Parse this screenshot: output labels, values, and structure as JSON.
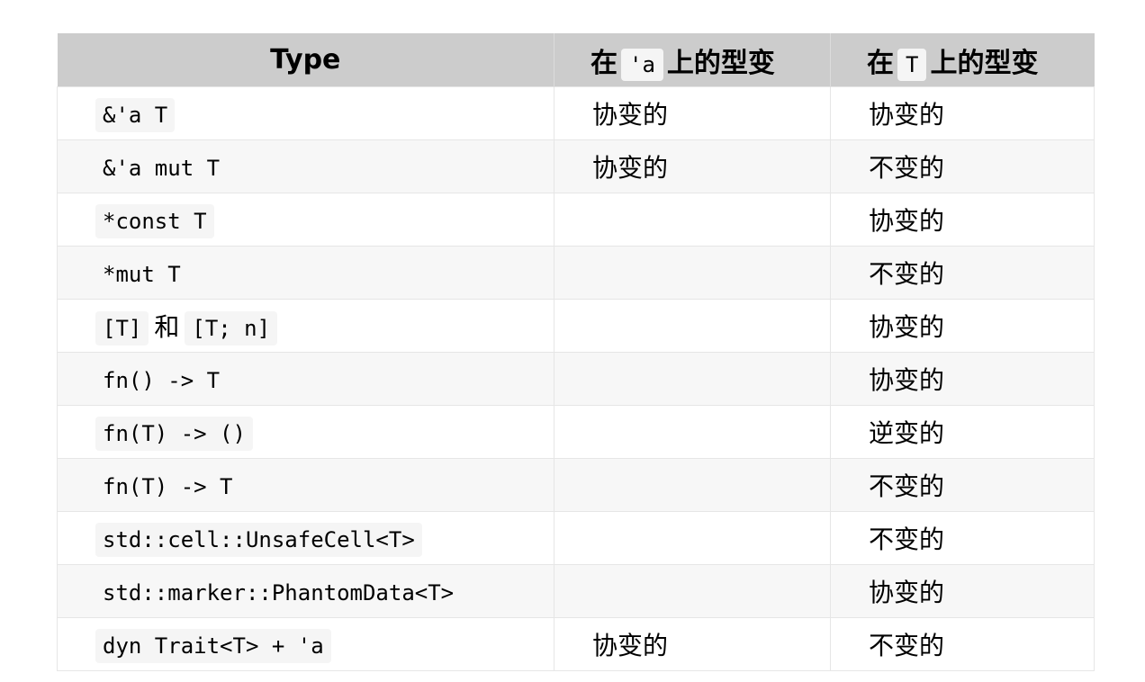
{
  "header": {
    "type_label": "Type",
    "col2_prefix": "在",
    "col2_code": "'a",
    "col2_suffix": "上的型变",
    "col3_prefix": "在",
    "col3_code": "T",
    "col3_suffix": "上的型变"
  },
  "rows": [
    {
      "type": "&'a T",
      "a": "协变的",
      "t": "协变的"
    },
    {
      "type": "&'a mut T",
      "a": "协变的",
      "t": "不变的"
    },
    {
      "type": "*const T",
      "a": "",
      "t": "协变的"
    },
    {
      "type": "*mut T",
      "a": "",
      "t": "不变的"
    },
    {
      "type_a": "[T]",
      "type_join": "和",
      "type_b": "[T; n]",
      "a": "",
      "t": "协变的"
    },
    {
      "type": "fn() -> T",
      "a": "",
      "t": "协变的"
    },
    {
      "type": "fn(T) -> ()",
      "a": "",
      "t": "逆变的"
    },
    {
      "type": "fn(T) -> T",
      "a": "",
      "t": "不变的"
    },
    {
      "type": "std::cell::UnsafeCell<T>",
      "a": "",
      "t": "不变的"
    },
    {
      "type": "std::marker::PhantomData<T>",
      "a": "",
      "t": "协变的"
    },
    {
      "type": "dyn Trait<T> + 'a",
      "a": "协变的",
      "t": "不变的"
    }
  ]
}
